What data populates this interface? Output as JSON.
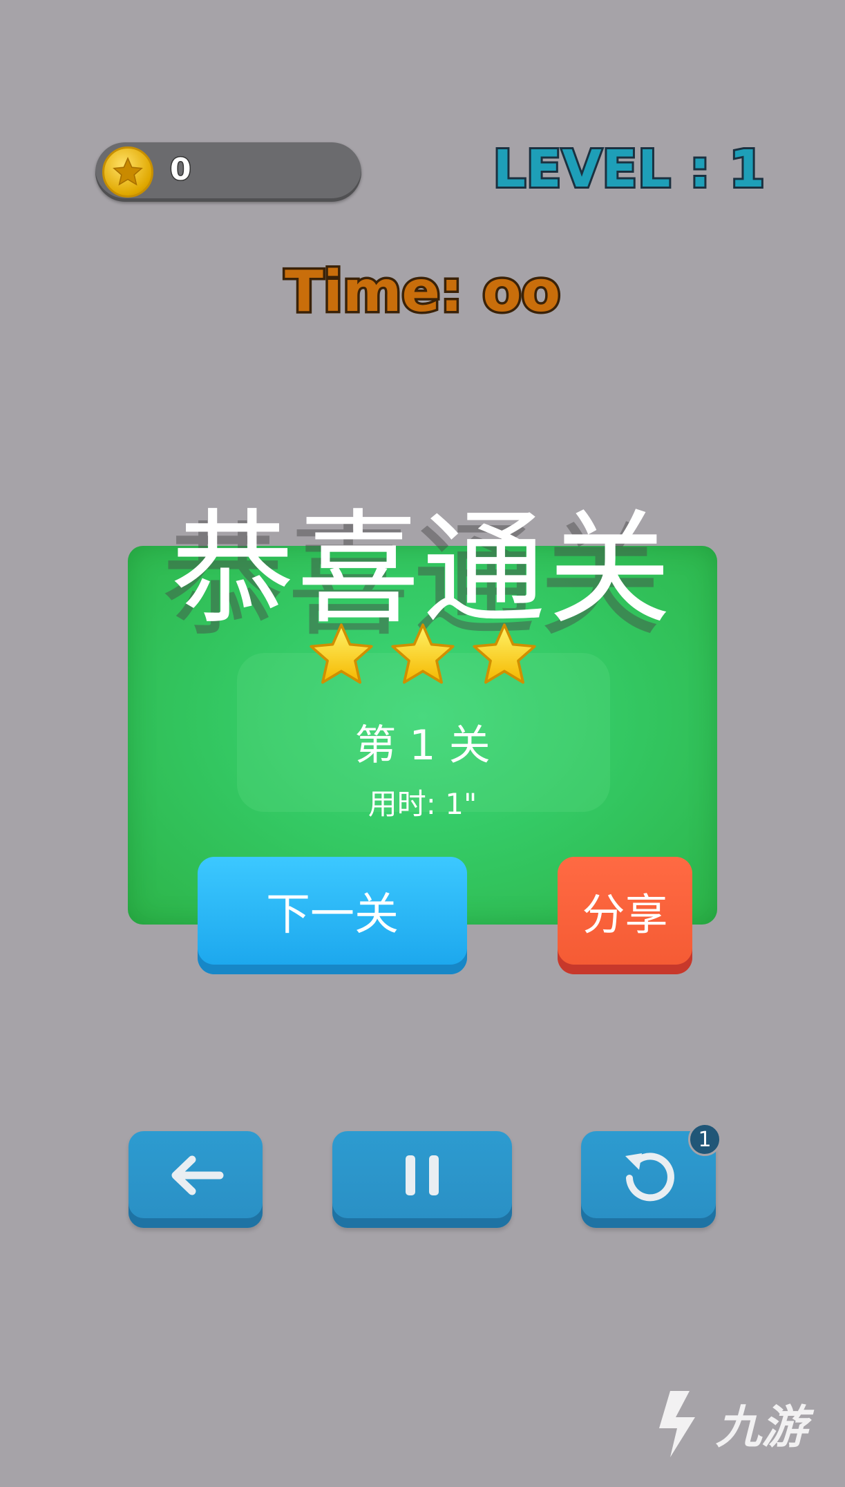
{
  "hud": {
    "coins": "0",
    "level": "LEVEL : 1",
    "time": "Time: oo"
  },
  "result": {
    "headline": "恭喜通关",
    "stars_earned": 3,
    "stars_total": 3,
    "stage_label": "第 1 关",
    "time_used": "用时: 1\""
  },
  "actions": {
    "next_label": "下一关",
    "share_label": "分享"
  },
  "controls": {
    "back_icon": "arrow-left-icon",
    "pause_icon": "pause-icon",
    "undo_icon": "undo-icon",
    "undo_badge": "1"
  },
  "watermark": {
    "text": "九游"
  },
  "colors": {
    "background": "#a6a3a8",
    "panel": "#34c964",
    "next_button": "#1aa5ec",
    "share_button": "#f45a33",
    "control_button": "#2a8fc4",
    "level_text": "#1e9fb8",
    "time_text": "#c96e0b"
  }
}
